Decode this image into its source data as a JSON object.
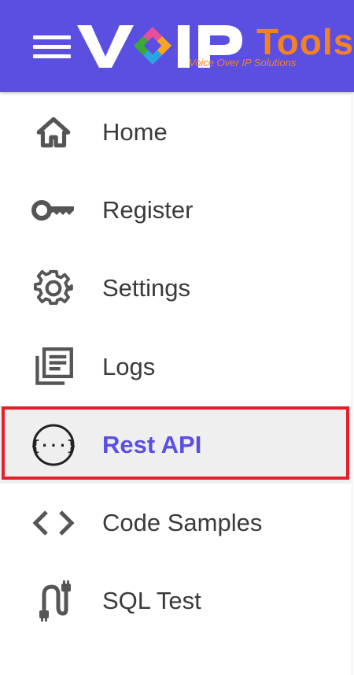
{
  "header": {
    "menu_icon": "hamburger-menu-icon",
    "logo": {
      "brand_v_i_p": "VoIP",
      "brand_tools": "Tools",
      "tagline": "Voice Over IP Solutions"
    },
    "colors": {
      "header_bg": "#5b4fe2",
      "logo_accent": "#f58220"
    }
  },
  "nav": {
    "items": [
      {
        "label": "Home",
        "icon": "home-icon"
      },
      {
        "label": "Register",
        "icon": "key-icon"
      },
      {
        "label": "Settings",
        "icon": "gear-icon"
      },
      {
        "label": "Logs",
        "icon": "logs-icon"
      },
      {
        "label": "Rest API",
        "icon": "api-braces-icon",
        "active": true
      },
      {
        "label": "Code Samples",
        "icon": "code-brackets-icon"
      },
      {
        "label": "SQL Test",
        "icon": "sql-plug-icon"
      }
    ],
    "active_color": "#5b4fe2",
    "highlight_color": "#e41e2b"
  }
}
